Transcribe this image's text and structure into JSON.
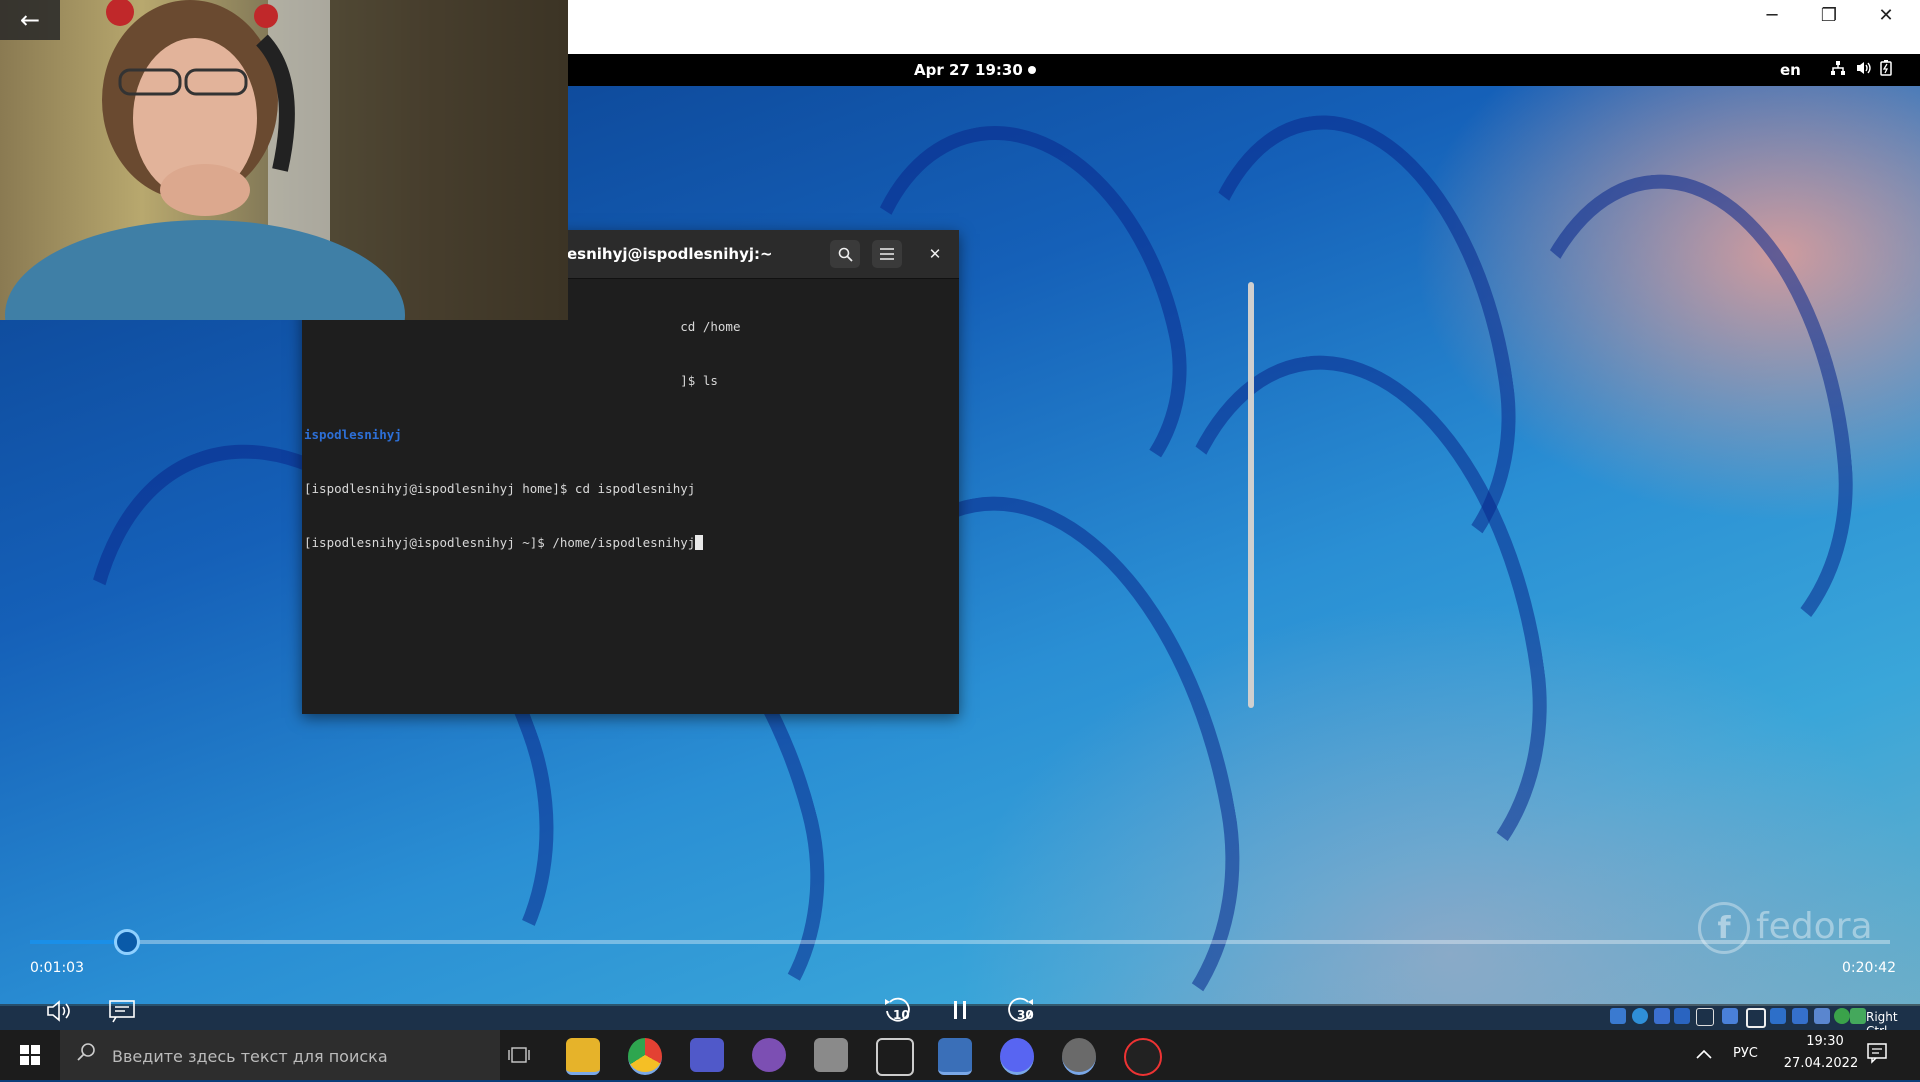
{
  "player": {
    "back_glyph": "←",
    "window_controls": {
      "minimize": "─",
      "maximize": "❐",
      "close": "✕"
    },
    "time_current": "0:01:03",
    "time_total": "0:20:42",
    "progress_fraction": 0.0507,
    "skip_back_label": "10",
    "skip_forward_label": "30"
  },
  "gnome": {
    "clock": "Apr 27  19:30",
    "lang": "en"
  },
  "terminal": {
    "title": "esnihyj@ispodlesnihyj:~",
    "lines": [
      {
        "text": "                                                  cd /home"
      },
      {
        "text": "                                                  ]$ ls"
      },
      {
        "text": "ispodlesnihyj",
        "highlight": true
      },
      {
        "text": "[ispodlesnihyj@ispodlesnihyj home]$ cd ispodlesnihyj"
      },
      {
        "text": "[ispodlesnihyj@ispodlesnihyj ~]$ /home/ispodlesnihyj",
        "cursor": true
      }
    ]
  },
  "watermark": {
    "logo_glyph": "f",
    "text": "fedora"
  },
  "vm": {
    "right_ctrl": "Right Ctrl"
  },
  "taskbar": {
    "search_placeholder": "Введите здесь текст для поиска",
    "lang": "РУС",
    "time": "19:30",
    "date": "27.04.2022"
  },
  "colors": {
    "seek_fill": "#1a8fe8",
    "taskbar_bg": "#1c1c1c",
    "terminal_bg": "#1e1e1e"
  }
}
